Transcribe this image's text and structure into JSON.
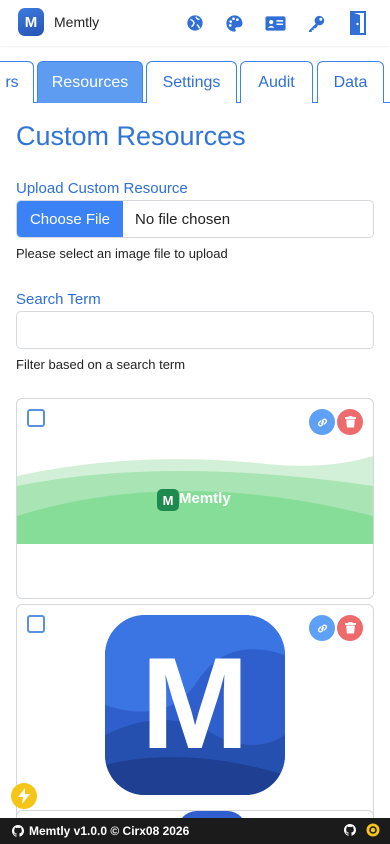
{
  "app": {
    "name": "Memtly",
    "logo_letter": "M"
  },
  "nav_icons": [
    "globe-icon",
    "palette-icon",
    "id-card-icon",
    "key-icon",
    "logout-door-icon"
  ],
  "tabs": [
    {
      "label": "rs",
      "active": false
    },
    {
      "label": "Resources",
      "active": true
    },
    {
      "label": "Settings",
      "active": false
    },
    {
      "label": "Audit",
      "active": false
    },
    {
      "label": "Data",
      "active": false
    }
  ],
  "page": {
    "title": "Custom Resources"
  },
  "upload": {
    "label": "Upload Custom Resource",
    "button_label": "Choose File",
    "status": "No file chosen",
    "help": "Please select an image file to upload"
  },
  "search": {
    "label": "Search Term",
    "value": "",
    "placeholder": "",
    "help": "Filter based on a search term"
  },
  "resources": [
    {
      "banner_text": "Memtly",
      "banner_mark": "M",
      "checked": false
    },
    {
      "icon_letter": "M",
      "checked": false
    }
  ],
  "footer": {
    "text": "Memtly v1.0.0 © Cirx08 2026"
  },
  "colors": {
    "primary": "#3b82f6",
    "accent_text": "#2f6fd6",
    "danger": "#ee6b6b",
    "footer_bg": "#1b1b1b",
    "fab": "#f5c518"
  }
}
